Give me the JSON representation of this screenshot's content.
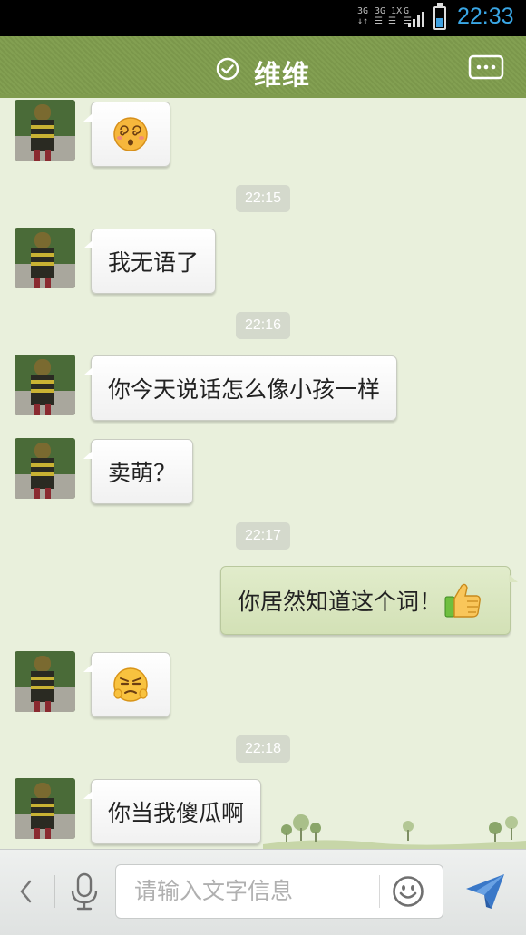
{
  "status_bar": {
    "net_1": "3G\n↓↑",
    "net_2": "3G 1X\n☰ ☰",
    "net_3": "G\n☰",
    "time": "22:33"
  },
  "header": {
    "title": "维维",
    "verified_icon": "check-circle-icon",
    "more_icon": "chat-more-icon"
  },
  "messages": [
    {
      "side": "in",
      "type": "emoji",
      "emoji": "dizzy-face"
    },
    {
      "type": "time",
      "text": "22:15"
    },
    {
      "side": "in",
      "type": "text",
      "text": "我无语了"
    },
    {
      "type": "time",
      "text": "22:16"
    },
    {
      "side": "in",
      "type": "text",
      "text": "你今天说话怎么像小孩一样"
    },
    {
      "side": "in",
      "type": "text",
      "text": "卖萌？"
    },
    {
      "type": "time",
      "text": "22:17"
    },
    {
      "side": "out",
      "type": "text",
      "text": "你居然知道这个词！",
      "emoji": "thumbs-up"
    },
    {
      "side": "in",
      "type": "emoji",
      "emoji": "annoyed-face"
    },
    {
      "type": "time",
      "text": "22:18"
    },
    {
      "side": "in",
      "type": "text",
      "text": "你当我傻瓜啊"
    }
  ],
  "input_bar": {
    "placeholder": "请输入文字信息",
    "back_icon": "chevron-left-icon",
    "mic_icon": "microphone-icon",
    "emoji_icon": "smiley-icon",
    "send_icon": "paper-plane-send-icon"
  },
  "colors": {
    "header": "#7f9b4e",
    "chat_bg": "#e9f0dc",
    "outgoing_bubble": "#d8e4be",
    "status_time": "#3aa7e6",
    "send_icon": "#3a78c8"
  }
}
